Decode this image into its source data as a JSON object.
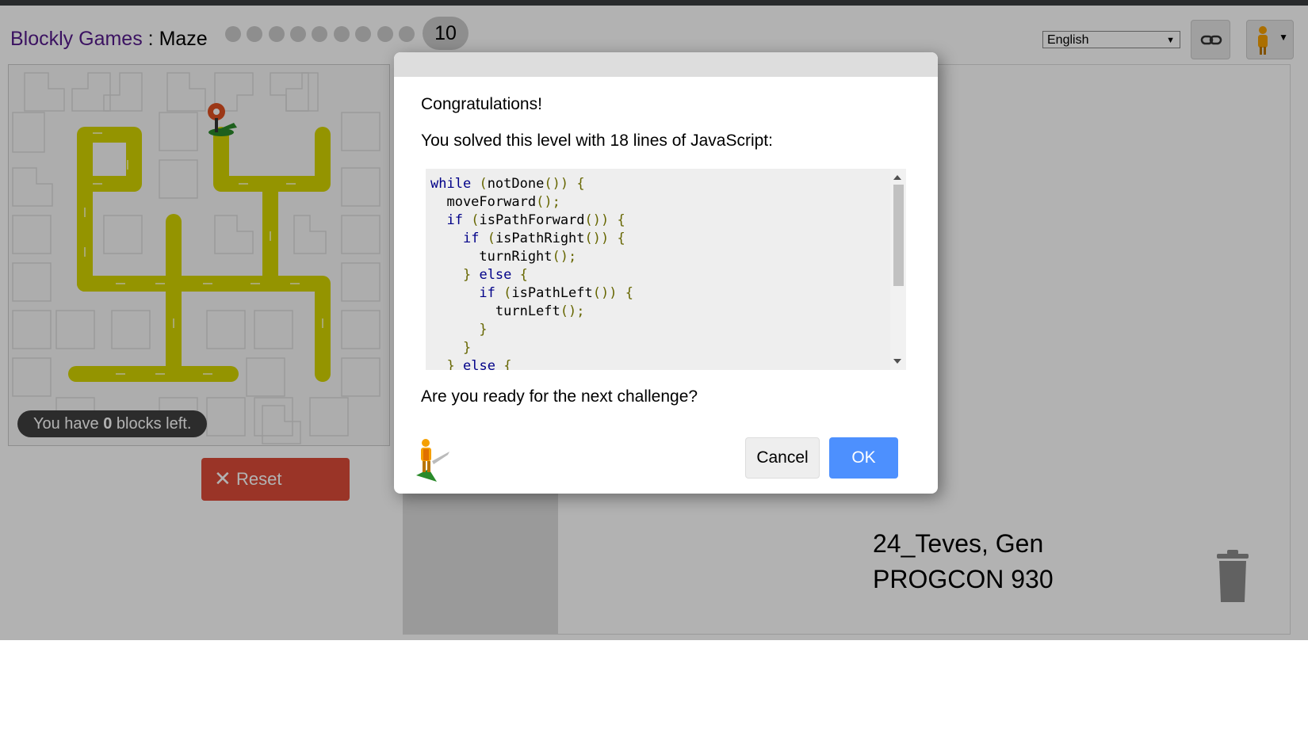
{
  "header": {
    "title_games": "Blockly Games",
    "title_sep": " : ",
    "title_game": "Maze",
    "levels": [
      "1",
      "2",
      "3",
      "4",
      "5",
      "6",
      "7",
      "8",
      "9"
    ],
    "current_level": "10",
    "language": "English"
  },
  "maze": {
    "capacity_prefix": "You have ",
    "capacity_count": "0",
    "capacity_suffix": " blocks left.",
    "reset_label": "Reset"
  },
  "dialog": {
    "congrats": "Congratulations!",
    "lines_message": "You solved this level with 18 lines of JavaScript:",
    "code": [
      "while (notDone()) {",
      "  moveForward();",
      "  if (isPathForward()) {",
      "    if (isPathRight()) {",
      "      turnRight();",
      "    } else {",
      "      if (isPathLeft()) {",
      "        turnLeft();",
      "      }",
      "    }",
      "  } else {"
    ],
    "next_prompt": "Are you ready for the next challenge?",
    "cancel_label": "Cancel",
    "ok_label": "OK"
  },
  "workspace": {
    "author_line1": "24_Teves, Gen",
    "author_line2": "PROGCON 930"
  },
  "colors": {
    "path": "#d4d400",
    "reset": "#dd4b39",
    "ok": "#4d90fe",
    "title_link": "#551a8b"
  },
  "icons": [
    "link-icon",
    "pegman-icon",
    "close-icon",
    "trash-icon",
    "goal-marker-icon"
  ]
}
